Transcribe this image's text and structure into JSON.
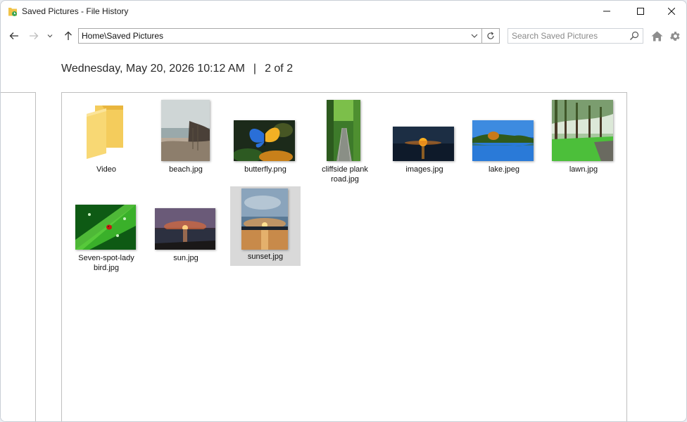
{
  "window": {
    "title": "Saved Pictures - File History"
  },
  "nav": {
    "address": "Home\\Saved Pictures",
    "search_placeholder": "Search Saved Pictures"
  },
  "header": {
    "date": "Wednesday, May 20, 2026 10:12 AM",
    "separator": "|",
    "page_indicator": "2 of 2"
  },
  "items": [
    {
      "name": "Video",
      "type": "folder"
    },
    {
      "name": "beach.jpg",
      "type": "image"
    },
    {
      "name": "butterfly.png",
      "type": "image"
    },
    {
      "name": "cliffside plank road.jpg",
      "type": "image"
    },
    {
      "name": "images.jpg",
      "type": "image"
    },
    {
      "name": "lake.jpeg",
      "type": "image"
    },
    {
      "name": "lawn.jpg",
      "type": "image"
    },
    {
      "name": "Seven-spot-lady bird.jpg",
      "type": "image"
    },
    {
      "name": "sun.jpg",
      "type": "image"
    },
    {
      "name": "sunset.jpg",
      "type": "image",
      "selected": true
    }
  ],
  "icons": {
    "app": "folder-history-icon",
    "back": "back-arrow-icon",
    "forward": "forward-arrow-icon",
    "recent": "chevron-down-icon",
    "up": "up-arrow-icon",
    "refresh": "refresh-icon",
    "search": "search-icon",
    "home": "home-icon",
    "settings": "gear-icon"
  },
  "colors": {
    "selection": "#d9d9d9",
    "folder": "#f3cc5a"
  }
}
